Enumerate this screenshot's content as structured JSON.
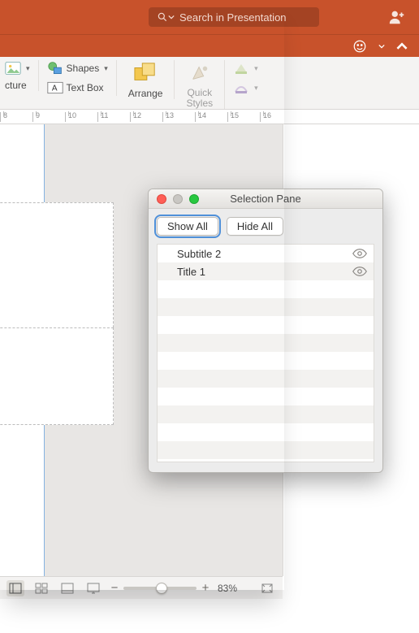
{
  "titlebar": {
    "search_placeholder": "Search in Presentation"
  },
  "ribbon": {
    "picture_label": "cture",
    "shapes_label": "Shapes",
    "textbox_label": "Text Box",
    "arrange_label": "Arrange",
    "quickstyles_label": "Quick\nStyles"
  },
  "ruler": {
    "marks": [
      "8",
      "9",
      "10",
      "11",
      "12",
      "13",
      "14",
      "15",
      "16"
    ]
  },
  "statusbar": {
    "zoom_pct": "83%",
    "minus": "−",
    "plus": "+"
  },
  "selection_pane": {
    "title": "Selection Pane",
    "show_all": "Show All",
    "hide_all": "Hide All",
    "items": [
      {
        "label": "Subtitle 2",
        "visible": true
      },
      {
        "label": "Title 1",
        "visible": true
      }
    ],
    "empty_rows": 10
  }
}
